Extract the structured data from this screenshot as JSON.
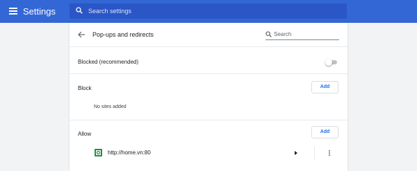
{
  "app": {
    "title": "Settings",
    "search_placeholder": "Search settings"
  },
  "page": {
    "title": "Pop-ups and redirects",
    "search_placeholder": "Search"
  },
  "blocked_toggle": {
    "label": "Blocked (recommended)",
    "enabled": false
  },
  "block_section": {
    "label": "Block",
    "add_label": "Add",
    "empty_text": "No sites added"
  },
  "allow_section": {
    "label": "Allow",
    "add_label": "Add",
    "sites": [
      {
        "url": "http://home.vn:80",
        "icon": "favicon-icon"
      }
    ]
  },
  "colors": {
    "header": "#3367d6",
    "accent": "#1a73e8",
    "favicon": "#1e8e3e"
  }
}
